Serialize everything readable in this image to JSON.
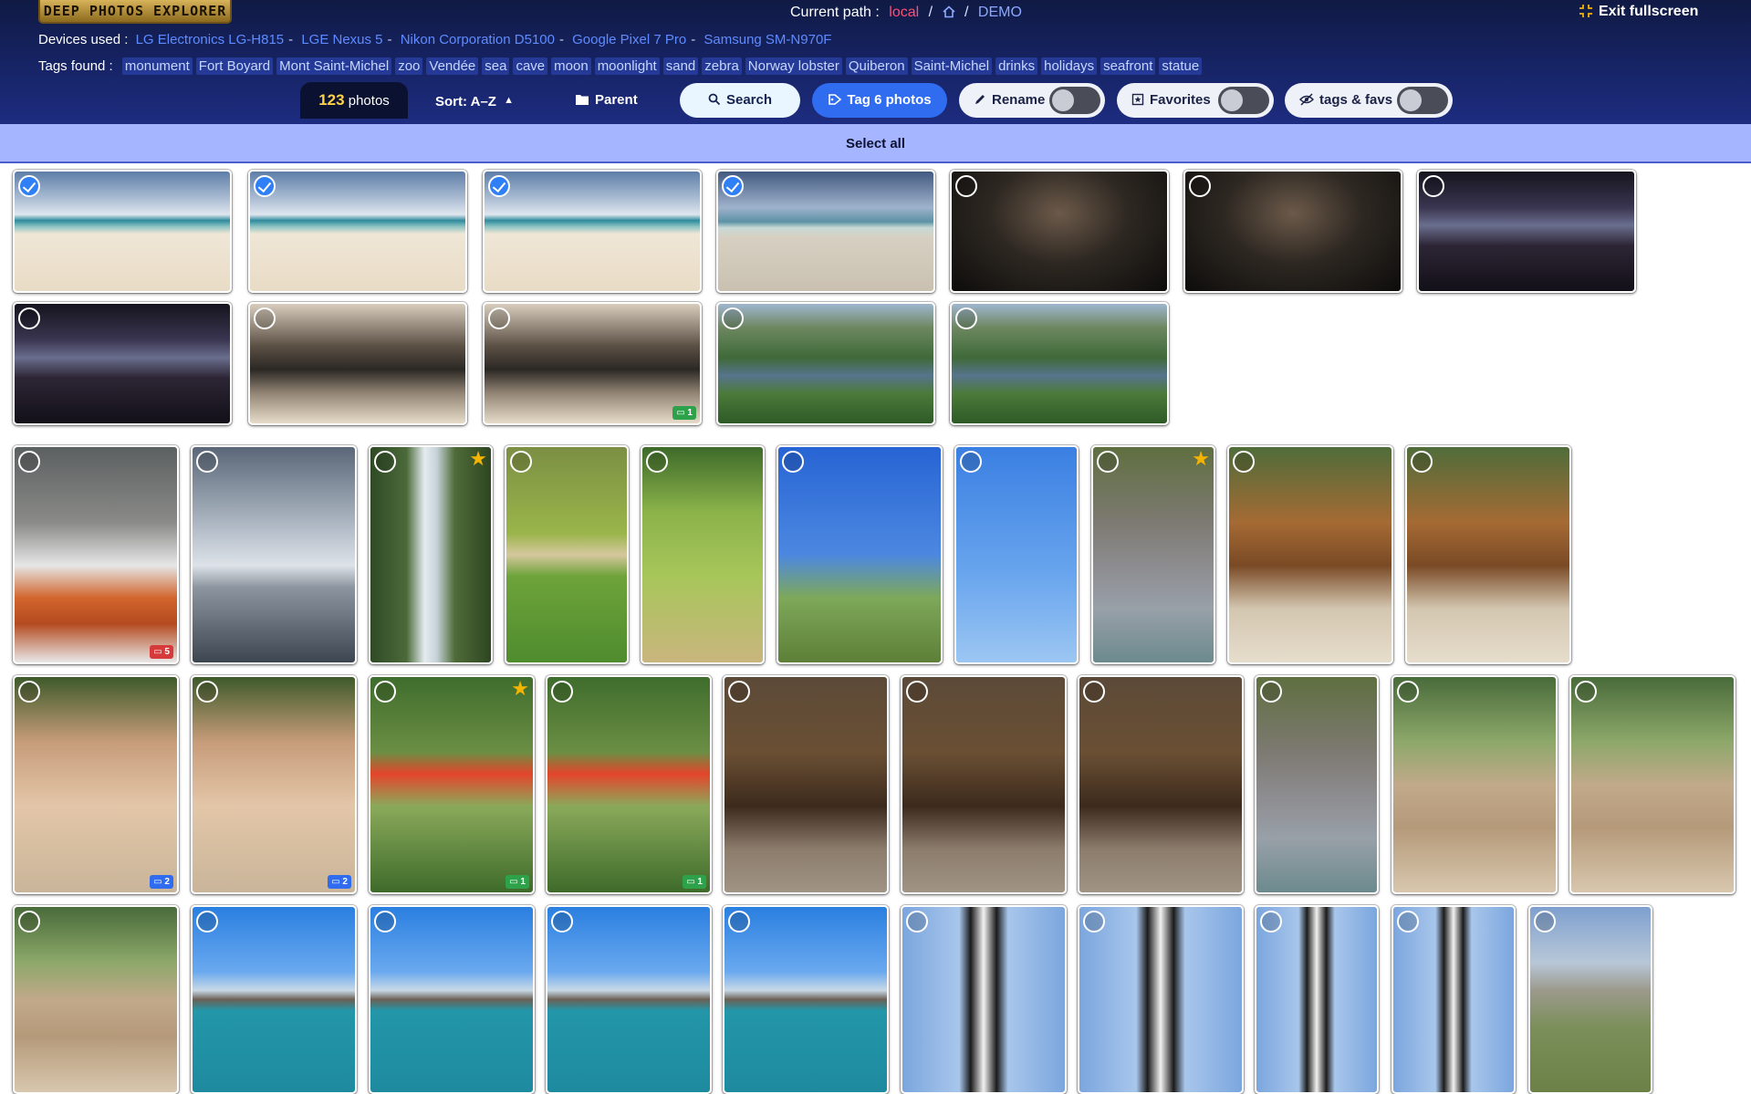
{
  "app": {
    "logo_text": "DEEP PHOTOS EXPLORER",
    "accent_color": "#2f6cf0",
    "header_color": "#172466"
  },
  "path": {
    "label": "Current path :",
    "root": "local",
    "sep": "/",
    "folder": "DEMO"
  },
  "exit_fullscreen": "Exit fullscreen",
  "devices": {
    "label": "Devices used :",
    "items": [
      "LG Electronics LG-H815",
      "LGE Nexus 5",
      "Nikon Corporation D5100",
      "Google Pixel 7 Pro",
      "Samsung SM-N970F"
    ],
    "sep": "-"
  },
  "tags": {
    "label": "Tags found :",
    "items": [
      "monument",
      "Fort Boyard",
      "Mont Saint-Michel",
      "zoo",
      "Vendée",
      "sea",
      "cave",
      "moon",
      "moonlight",
      "sand",
      "zebra",
      "Norway lobster",
      "Quiberon",
      "Saint-Michel",
      "drinks",
      "holidays",
      "seafront",
      "statue"
    ]
  },
  "toolbar": {
    "count": "123",
    "count_label": "photos",
    "sort": "Sort: A–Z",
    "parent": "Parent",
    "search": "Search",
    "tag": "Tag 6 photos",
    "rename": "Rename",
    "favorites": "Favorites",
    "tags_favs": "tags & favs"
  },
  "select_all": "Select all",
  "photos": [
    {
      "kind": "beach",
      "selected": true
    },
    {
      "kind": "beach",
      "selected": true
    },
    {
      "kind": "beach",
      "selected": true
    },
    {
      "kind": "beach4",
      "selected": true
    },
    {
      "kind": "cave"
    },
    {
      "kind": "cave"
    },
    {
      "kind": "cave2"
    },
    {
      "kind": "cave2"
    },
    {
      "kind": "rock"
    },
    {
      "kind": "rock",
      "badge": "1",
      "badge_color": "green"
    },
    {
      "kind": "river"
    },
    {
      "kind": "river"
    },
    {
      "kind": "food",
      "badge": "5",
      "badge_color": "red"
    },
    {
      "kind": "harbor"
    },
    {
      "kind": "falls",
      "star": true
    },
    {
      "kind": "lion"
    },
    {
      "kind": "emu"
    },
    {
      "kind": "sky"
    },
    {
      "kind": "bridge"
    },
    {
      "kind": "hippo",
      "star": true
    },
    {
      "kind": "giraffe"
    },
    {
      "kind": "giraffe"
    },
    {
      "kind": "zebrabg",
      "badge": "2",
      "badge_color": "blue"
    },
    {
      "kind": "zebrabg",
      "badge": "2",
      "badge_color": "blue"
    },
    {
      "kind": "ibis",
      "star": true,
      "badge": "1",
      "badge_color": "green"
    },
    {
      "kind": "ibis",
      "badge": "1",
      "badge_color": "green"
    },
    {
      "kind": "donkey"
    },
    {
      "kind": "donkey"
    },
    {
      "kind": "donkey"
    },
    {
      "kind": "hippo"
    },
    {
      "kind": "elephant"
    },
    {
      "kind": "elephant"
    },
    {
      "kind": "elephant"
    },
    {
      "kind": "fort"
    },
    {
      "kind": "fort"
    },
    {
      "kind": "fort"
    },
    {
      "kind": "fort"
    },
    {
      "kind": "lighthouse"
    },
    {
      "kind": "lighthouse"
    },
    {
      "kind": "lighthouse"
    },
    {
      "kind": "lighthouse"
    },
    {
      "kind": "msm"
    }
  ]
}
